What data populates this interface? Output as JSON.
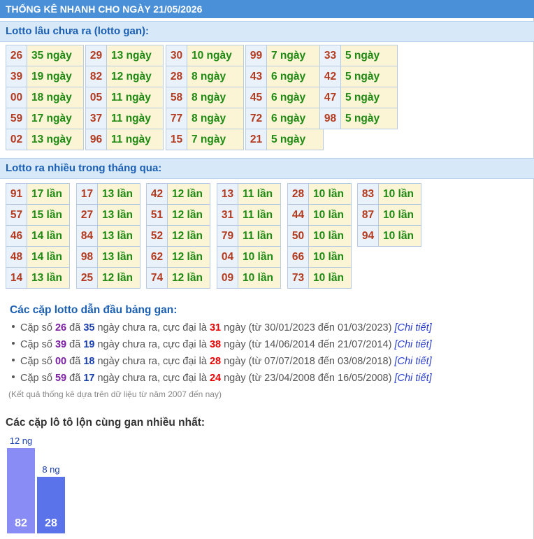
{
  "header": {
    "title": "THỐNG KÊ NHANH CHO NGÀY 21/05/2026"
  },
  "gan": {
    "title": "Lotto lâu chưa ra (lotto gan):",
    "columns": [
      [
        {
          "n": "26",
          "v": "35 ngày"
        },
        {
          "n": "39",
          "v": "19 ngày"
        },
        {
          "n": "00",
          "v": "18 ngày"
        },
        {
          "n": "59",
          "v": "17 ngày"
        },
        {
          "n": "02",
          "v": "13 ngày"
        }
      ],
      [
        {
          "n": "29",
          "v": "13 ngày"
        },
        {
          "n": "82",
          "v": "12 ngày"
        },
        {
          "n": "05",
          "v": "11 ngày"
        },
        {
          "n": "37",
          "v": "11 ngày"
        },
        {
          "n": "96",
          "v": "11 ngày"
        }
      ],
      [
        {
          "n": "30",
          "v": "10 ngày"
        },
        {
          "n": "28",
          "v": "8 ngày"
        },
        {
          "n": "58",
          "v": "8 ngày"
        },
        {
          "n": "77",
          "v": "8 ngày"
        },
        {
          "n": "15",
          "v": "7 ngày"
        }
      ],
      [
        {
          "n": "99",
          "v": "7 ngày"
        },
        {
          "n": "43",
          "v": "6 ngày"
        },
        {
          "n": "45",
          "v": "6 ngày"
        },
        {
          "n": "72",
          "v": "6 ngày"
        },
        {
          "n": "21",
          "v": "5 ngày"
        }
      ],
      [
        {
          "n": "33",
          "v": "5 ngày"
        },
        {
          "n": "42",
          "v": "5 ngày"
        },
        {
          "n": "47",
          "v": "5 ngày"
        },
        {
          "n": "98",
          "v": "5 ngày"
        }
      ]
    ]
  },
  "frequent": {
    "title": "Lotto ra nhiều trong tháng qua:",
    "columns": [
      [
        {
          "n": "91",
          "v": "17 lần"
        },
        {
          "n": "57",
          "v": "15 lần"
        },
        {
          "n": "46",
          "v": "14 lần"
        },
        {
          "n": "48",
          "v": "14 lần"
        },
        {
          "n": "14",
          "v": "13 lần"
        }
      ],
      [
        {
          "n": "17",
          "v": "13 lần"
        },
        {
          "n": "27",
          "v": "13 lần"
        },
        {
          "n": "84",
          "v": "13 lần"
        },
        {
          "n": "98",
          "v": "13 lần"
        },
        {
          "n": "25",
          "v": "12 lần"
        }
      ],
      [
        {
          "n": "42",
          "v": "12 lần"
        },
        {
          "n": "51",
          "v": "12 lần"
        },
        {
          "n": "52",
          "v": "12 lần"
        },
        {
          "n": "62",
          "v": "12 lần"
        },
        {
          "n": "74",
          "v": "12 lần"
        }
      ],
      [
        {
          "n": "13",
          "v": "11 lần"
        },
        {
          "n": "31",
          "v": "11 lần"
        },
        {
          "n": "79",
          "v": "11 lần"
        },
        {
          "n": "04",
          "v": "10 lần"
        },
        {
          "n": "09",
          "v": "10 lần"
        }
      ],
      [
        {
          "n": "28",
          "v": "10 lần"
        },
        {
          "n": "44",
          "v": "10 lần"
        },
        {
          "n": "50",
          "v": "10 lần"
        },
        {
          "n": "66",
          "v": "10 lần"
        },
        {
          "n": "73",
          "v": "10 lần"
        }
      ],
      [
        {
          "n": "83",
          "v": "10 lần"
        },
        {
          "n": "87",
          "v": "10 lần"
        },
        {
          "n": "94",
          "v": "10 lần"
        }
      ]
    ]
  },
  "leaders": {
    "title": "Các cặp lotto dẫn đầu bảng gan:",
    "items": [
      {
        "pre": "Cặp số",
        "num": "26",
        "mid1": "đã",
        "days": "35",
        "mid2": "ngày chưa ra, cực đại là",
        "max": "31",
        "post": "ngày (từ 30/01/2023 đến 01/03/2023)",
        "link": "[Chi tiết]"
      },
      {
        "pre": "Cặp số",
        "num": "39",
        "mid1": "đã",
        "days": "19",
        "mid2": "ngày chưa ra, cực đại là",
        "max": "38",
        "post": "ngày (từ 14/06/2014 đến 21/07/2014)",
        "link": "[Chi tiết]"
      },
      {
        "pre": "Cặp số",
        "num": "00",
        "mid1": "đã",
        "days": "18",
        "mid2": "ngày chưa ra, cực đại là",
        "max": "28",
        "post": "ngày (từ 07/07/2018 đến 03/08/2018)",
        "link": "[Chi tiết]"
      },
      {
        "pre": "Cặp số",
        "num": "59",
        "mid1": "đã",
        "days": "17",
        "mid2": "ngày chưa ra, cực đại là",
        "max": "24",
        "post": "ngày (từ 23/04/2008 đến 16/05/2008)",
        "link": "[Chi tiết]"
      }
    ],
    "note": "(Kết quả thống kê dựa trên dữ liệu từ năm 2007 đến nay)"
  },
  "pairs": {
    "title": "Các cặp lô tô lộn cùng gan nhiều nhất:",
    "bars": [
      {
        "top": "12 ng",
        "num": "82",
        "value": 12,
        "color": "#8a8cf5"
      },
      {
        "top": "8 ng",
        "num": "28",
        "value": 8,
        "color": "#5b73ea"
      }
    ]
  }
}
